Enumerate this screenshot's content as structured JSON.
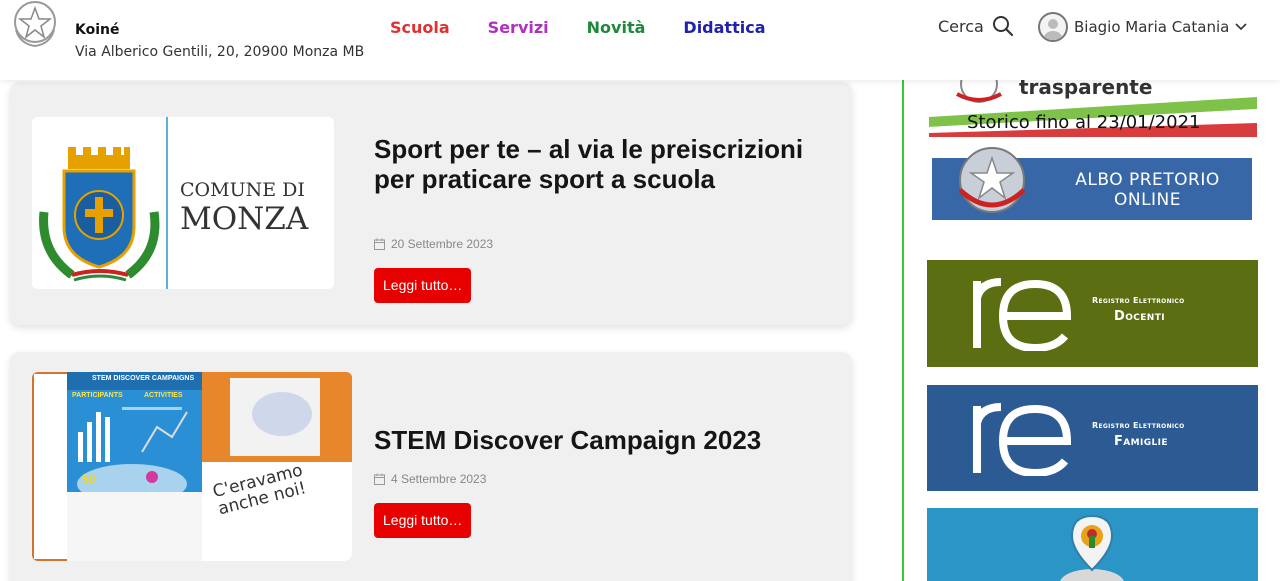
{
  "header": {
    "school_name": "Koiné",
    "school_address": "Via Alberico Gentili, 20, 20900 Monza MB",
    "nav": {
      "scuola": "Scuola",
      "servizi": "Servizi",
      "novita": "Novità",
      "didattica": "Didattica"
    },
    "search_label": "Cerca",
    "user_name": "Biagio Maria Catania"
  },
  "posts": [
    {
      "title": "Sport per te – al via le preiscrizioni per praticare sport a scuola",
      "date": "20 Settembre 2023",
      "read_more": "Leggi tutto…",
      "thumb": {
        "line1": "COMUNE DI",
        "line2": "MONZA"
      }
    },
    {
      "title": "STEM Discover Campaign 2023",
      "date": "4 Settembre 2023",
      "read_more": "Leggi tutto…",
      "thumb": {
        "headline": "STEM DISCOVER CAMPAIGNS",
        "participants": "PARTICIPANTS",
        "activities": "ACTIVITIES",
        "stat": "50",
        "caption_line1": "C'eravamo",
        "caption_line2": "anche noi!"
      }
    }
  ],
  "sidebar": {
    "trasparente_text": "trasparente",
    "storico_text": "Storico fino al 23/01/2021",
    "albo_line1": "ALBO PRETORIO",
    "albo_line2": "ONLINE",
    "registro_docenti": {
      "small": "Registro Elettronico",
      "big": "Docenti"
    },
    "registro_famiglie": {
      "small": "Registro Elettronico",
      "big": "Famiglie"
    }
  },
  "colors": {
    "nav_scuola": "#e03030",
    "nav_servizi": "#b030c0",
    "nav_novita": "#1b8a3a",
    "nav_didattica": "#2020b0",
    "read_more_bg": "#e60000",
    "docenti_bg": "#5b6f12",
    "famiglie_bg": "#2c5b94",
    "albo_bg": "#3867a8",
    "divider": "#33cc33"
  },
  "icons": {
    "search": "search-icon",
    "avatar": "user-avatar-icon",
    "chevron": "chevron-down-icon",
    "calendar": "calendar-icon"
  }
}
